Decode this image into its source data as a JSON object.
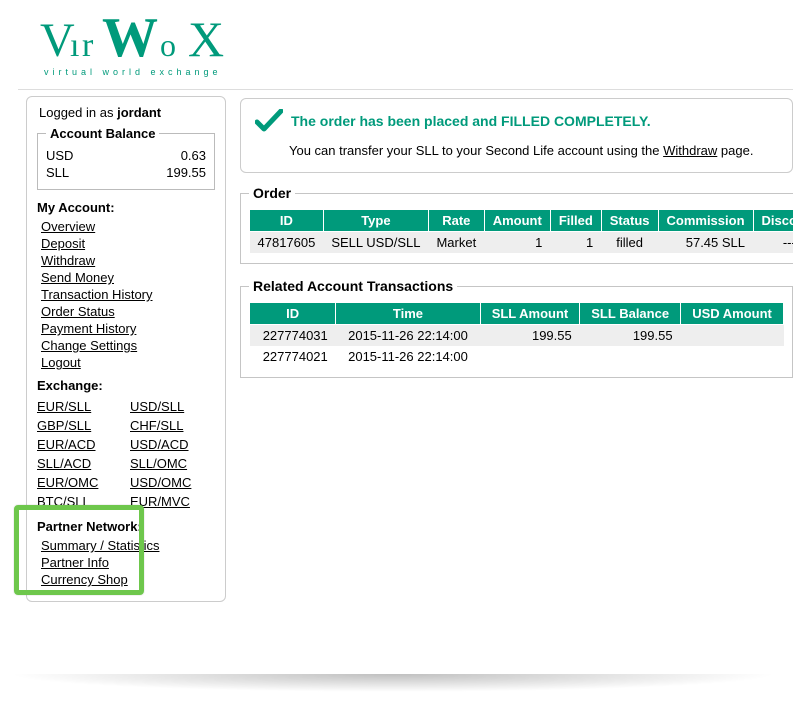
{
  "logo": {
    "sub": "virtual world exchange"
  },
  "sidebar": {
    "logged_in_prefix": "Logged in as ",
    "username": "jordant",
    "balance_legend": "Account Balance",
    "balances": [
      {
        "currency": "USD",
        "amount": "0.63"
      },
      {
        "currency": "SLL",
        "amount": "199.55"
      }
    ],
    "my_account_head": "My Account:",
    "my_account_links": [
      "Overview",
      "Deposit",
      "Withdraw",
      "Send Money",
      "Transaction History",
      "Order Status",
      "Payment History",
      "Change Settings",
      "Logout"
    ],
    "exchange_head": "Exchange:",
    "exchange_pairs_left": [
      "EUR/SLL",
      "GBP/SLL",
      "EUR/ACD",
      "SLL/ACD",
      "EUR/OMC",
      "BTC/SLL"
    ],
    "exchange_pairs_right": [
      "USD/SLL",
      "CHF/SLL",
      "USD/ACD",
      "SLL/OMC",
      "USD/OMC",
      "EUR/MVC"
    ],
    "partner_head": "Partner Network:",
    "partner_links": [
      "Summary / Statistics",
      "Partner Info",
      "Currency Shop"
    ]
  },
  "alert": {
    "text": "The order has been placed and FILLED COMPLETELY.",
    "sub_prefix": "You can transfer your SLL to your Second Life account using the ",
    "withdraw_label": "Withdraw",
    "sub_suffix": " page."
  },
  "order_panel": {
    "legend": "Order",
    "headers": [
      "ID",
      "Type",
      "Rate",
      "Amount",
      "Filled",
      "Status",
      "Commission",
      "Discount"
    ],
    "row": {
      "id": "47817605",
      "type": "SELL USD/SLL",
      "rate": "Market",
      "amount": "1",
      "filled": "1",
      "status": "filled",
      "commission": "57.45 SLL",
      "discount": "---"
    }
  },
  "tx_panel": {
    "legend": "Related Account Transactions",
    "headers": [
      "ID",
      "Time",
      "SLL Amount",
      "SLL Balance",
      "USD Amount"
    ],
    "rows": [
      {
        "id": "227774031",
        "time": "2015-11-26 22:14:00",
        "sll_amount": "199.55",
        "sll_balance": "199.55",
        "usd_amount": ""
      },
      {
        "id": "227774021",
        "time": "2015-11-26 22:14:00",
        "sll_amount": "",
        "sll_balance": "",
        "usd_amount": ""
      }
    ]
  }
}
